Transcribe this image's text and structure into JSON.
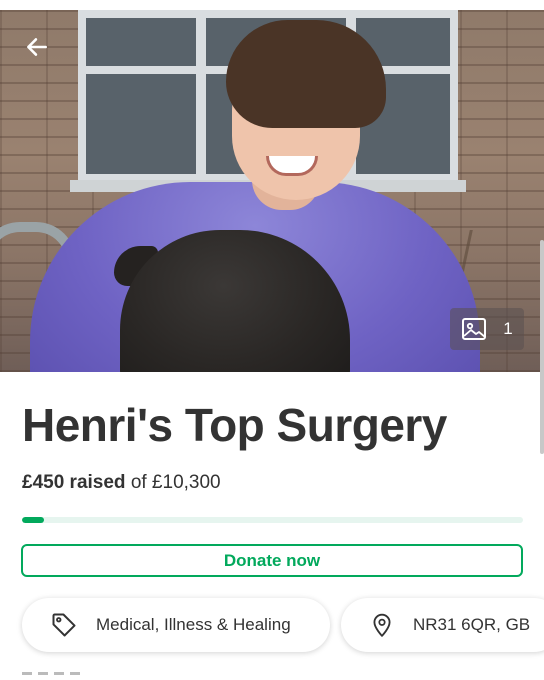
{
  "header": {
    "back_icon": "arrow-left-icon"
  },
  "hero": {
    "photo_count": "1",
    "photo_icon": "image-icon"
  },
  "campaign": {
    "title": "Henri's Top Surgery",
    "raised_amount": "£450 raised",
    "goal_text": "of £10,300",
    "progress_fraction": 0.0437,
    "donate_label": "Donate now"
  },
  "tags": {
    "category": {
      "icon": "tag-icon",
      "label": "Medical, Illness & Healing"
    },
    "location": {
      "icon": "location-pin-icon",
      "label": "NR31 6QR, GB"
    }
  },
  "colors": {
    "accent": "#02a95c",
    "progress_track": "#e6f5ef",
    "text": "#333333"
  }
}
